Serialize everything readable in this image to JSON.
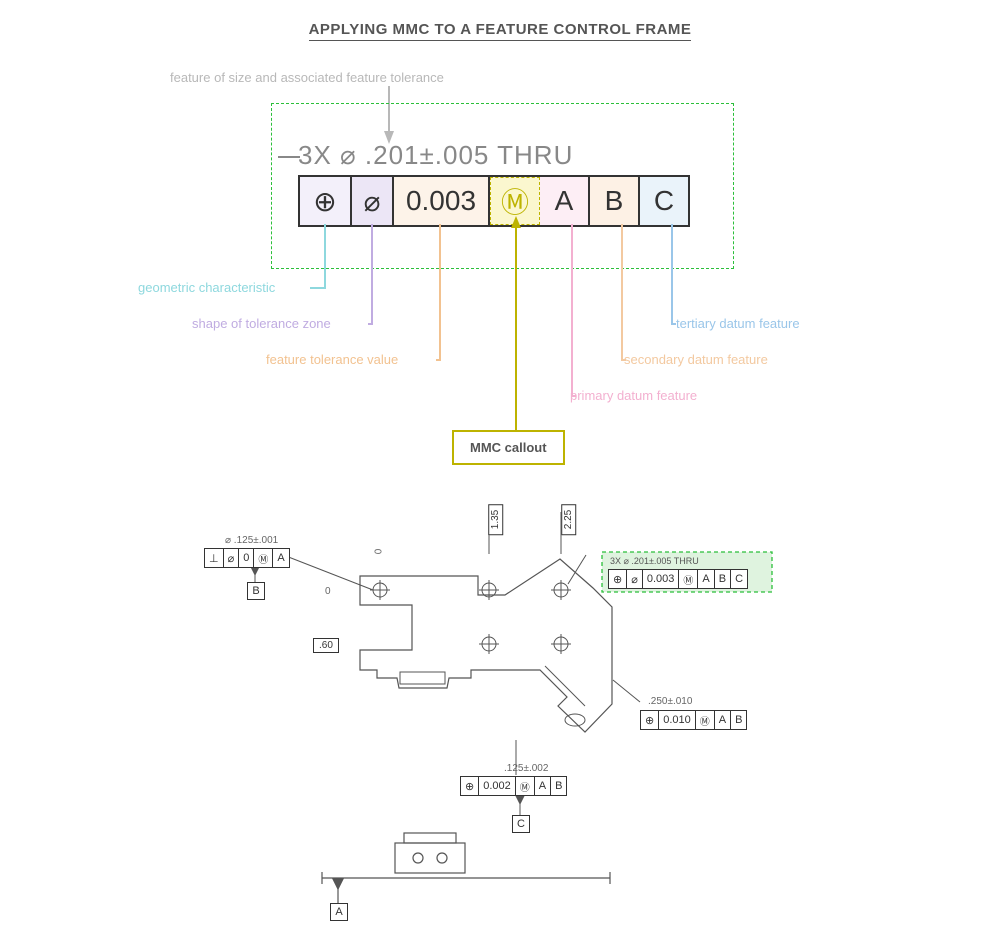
{
  "title": "APPLYING MMC TO A FEATURE CONTROL FRAME",
  "callout_labels": {
    "feature_of_size": "feature of size and associated feature tolerance",
    "geometric_characteristic": "geometric characteristic",
    "shape_of_tolerance_zone": "shape of tolerance zone",
    "feature_tolerance_value": "feature tolerance value",
    "mmc_callout": "MMC callout",
    "primary_datum": "primary datum feature",
    "secondary_datum": "secondary datum feature",
    "tertiary_datum": "tertiary datum feature"
  },
  "main_fcf": {
    "caption": "3X ⌀ .201±.005 THRU",
    "cells": {
      "characteristic": "⊕",
      "zone_shape": "⌀",
      "tolerance": "0.003",
      "modifier": "Ⓜ",
      "datum1": "A",
      "datum2": "B",
      "datum3": "C"
    }
  },
  "drawing": {
    "hole_callout": {
      "caption": "3X ⌀ .201±.005 THRU",
      "fcf": {
        "char": "⊕",
        "shape": "⌀",
        "tol": "0.003",
        "mod": "Ⓜ",
        "d1": "A",
        "d2": "B",
        "d3": "C"
      }
    },
    "left_callout": {
      "caption": "⌀ .125±.001",
      "fcf": {
        "char": "⊥",
        "shape": "⌀",
        "tol": "0",
        "mod": "Ⓜ",
        "d1": "A"
      },
      "datum": "B"
    },
    "right_callout": {
      "caption": ".250±.010",
      "fcf": {
        "char": "⊕",
        "tol": "0.010",
        "mod": "Ⓜ",
        "d1": "A",
        "d2": "B"
      }
    },
    "bottom_callout": {
      "caption": ".125±.002",
      "fcf": {
        "char": "⊕",
        "tol": "0.002",
        "mod": "Ⓜ",
        "d1": "A",
        "d2": "B"
      },
      "datum": "C"
    },
    "bottom_datum": "A",
    "dims": {
      "x0": "0",
      "y0": "0",
      "y1": "1.35",
      "y2": "2.25",
      "basic60": ".60"
    }
  }
}
